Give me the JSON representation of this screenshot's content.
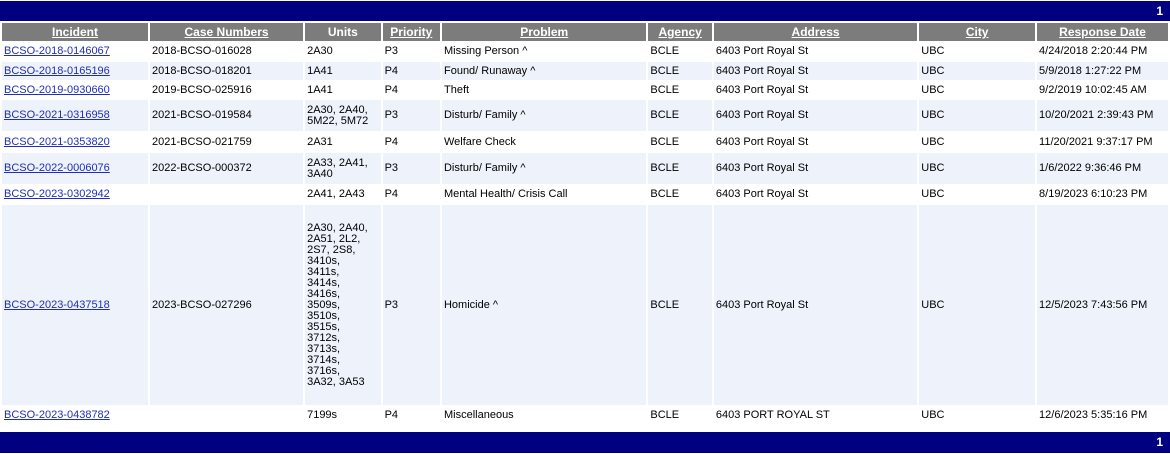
{
  "pager": {
    "top_page": "1",
    "bottom_page": "1"
  },
  "headers": [
    "Incident",
    "Case Numbers",
    "Units",
    "Priority",
    "Problem",
    "Agency",
    "Address",
    "City",
    "Response Date"
  ],
  "rows": [
    {
      "incident": "BCSO-2018-0146067",
      "case": "2018-BCSO-016028",
      "units": "2A30",
      "priority": "P3",
      "problem": "Missing Person ^",
      "agency": "BCLE",
      "address": "6403 Port Royal St",
      "city": "UBC",
      "date": "4/24/2018 2:20:44 PM"
    },
    {
      "incident": "BCSO-2018-0165196",
      "case": "2018-BCSO-018201",
      "units": "1A41",
      "priority": "P4",
      "problem": "Found/ Runaway ^",
      "agency": "BCLE",
      "address": "6403 Port Royal St",
      "city": "UBC",
      "date": "5/9/2018 1:27:22 PM"
    },
    {
      "incident": "BCSO-2019-0930660",
      "case": "2019-BCSO-025916",
      "units": "1A41",
      "priority": "P4",
      "problem": "Theft",
      "agency": "BCLE",
      "address": "6403 Port Royal St",
      "city": "UBC",
      "date": "9/2/2019 10:02:45 AM"
    },
    {
      "incident": "BCSO-2021-0316958",
      "case": "2021-BCSO-019584",
      "units": "2A30, 2A40,\n5M22, 5M72",
      "priority": "P3",
      "problem": "Disturb/ Family ^",
      "agency": "BCLE",
      "address": "6403 Port Royal St",
      "city": "UBC",
      "date": "10/20/2021 2:39:43 PM"
    },
    {
      "incident": "BCSO-2021-0353820",
      "case": "2021-BCSO-021759",
      "units": "2A31",
      "priority": "P4",
      "problem": "Welfare Check",
      "agency": "BCLE",
      "address": "6403 Port Royal St",
      "city": "UBC",
      "date": "11/20/2021 9:37:17 PM"
    },
    {
      "incident": "BCSO-2022-0006076",
      "case": "2022-BCSO-000372",
      "units": "2A33, 2A41,\n3A40",
      "priority": "P3",
      "problem": "Disturb/ Family ^",
      "agency": "BCLE",
      "address": "6403 Port Royal St",
      "city": "UBC",
      "date": "1/6/2022 9:36:46 PM"
    },
    {
      "incident": "BCSO-2023-0302942",
      "case": "",
      "units": "2A41, 2A43",
      "priority": "P4",
      "problem": "Mental Health/ Crisis Call",
      "agency": "BCLE",
      "address": "6403 Port Royal St",
      "city": "UBC",
      "date": "8/19/2023 6:10:23 PM"
    },
    {
      "incident": "BCSO-2023-0437518",
      "case": "2023-BCSO-027296",
      "units": "2A30, 2A40,\n2A51, 2L2,\n2S7, 2S8,\n3410s,\n3411s,\n3414s,\n3416s,\n3509s,\n3510s,\n3515s,\n3712s,\n3713s,\n3714s,\n3716s,\n3A32, 3A53",
      "priority": "P3",
      "problem": "Homicide ^",
      "agency": "BCLE",
      "address": "6403 Port Royal St",
      "city": "UBC",
      "date": "12/5/2023 7:43:56 PM"
    },
    {
      "incident": "BCSO-2023-0438782",
      "case": "",
      "units": "7199s",
      "priority": "P4",
      "problem": "Miscellaneous",
      "agency": "BCLE",
      "address": "6403 PORT ROYAL ST",
      "city": "UBC",
      "date": "12/6/2023 5:35:16 PM"
    }
  ],
  "colors": {
    "pager_bg": "#000080",
    "header_bg": "#7c7c7c",
    "alt_row_bg": "#eef2fb",
    "link": "#1f2fb7"
  }
}
